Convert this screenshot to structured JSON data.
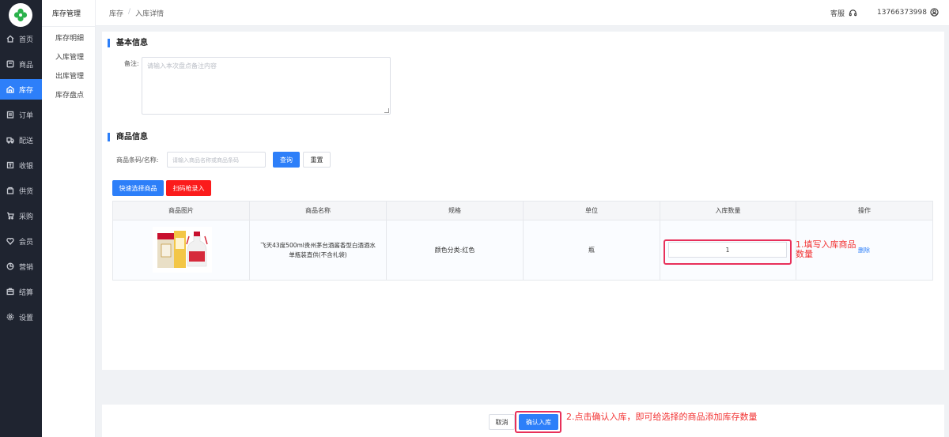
{
  "sidebar": {
    "items": [
      {
        "label": "首页",
        "icon": "home-icon",
        "active": false
      },
      {
        "label": "商品",
        "icon": "goods-icon",
        "active": false
      },
      {
        "label": "库存",
        "icon": "stock-icon",
        "active": true
      },
      {
        "label": "订单",
        "icon": "order-icon",
        "active": false
      },
      {
        "label": "配送",
        "icon": "truck-icon",
        "active": false
      },
      {
        "label": "收银",
        "icon": "cashier-icon",
        "active": false
      },
      {
        "label": "供货",
        "icon": "supply-icon",
        "active": false
      },
      {
        "label": "采购",
        "icon": "cart-icon",
        "active": false
      },
      {
        "label": "会员",
        "icon": "member-icon",
        "active": false
      },
      {
        "label": "营销",
        "icon": "marketing-icon",
        "active": false
      },
      {
        "label": "结算",
        "icon": "settle-icon",
        "active": false
      },
      {
        "label": "设置",
        "icon": "settings-icon",
        "active": false
      }
    ]
  },
  "subnav": {
    "title": "库存管理",
    "items": [
      "库存明细",
      "入库管理",
      "出库管理",
      "库存盘点"
    ]
  },
  "header": {
    "breadcrumb": [
      "库存",
      "入库详情"
    ],
    "service_label": "客服",
    "phone": "13766373998"
  },
  "basic": {
    "title": "基本信息",
    "remark_label": "备注:",
    "remark_placeholder": "请输入本次盘点备注内容"
  },
  "goods": {
    "title": "商品信息",
    "search_label": "商品条码/名称:",
    "search_placeholder": "请输入商品名称或商品条码",
    "query_button": "查询",
    "reset_button": "重置",
    "quick_select_button": "快速选择商品",
    "scan_button": "扫码枪录入",
    "columns": [
      "商品图片",
      "商品名称",
      "规格",
      "单位",
      "入库数量",
      "操作"
    ],
    "rows": [
      {
        "name": "飞天43度500ml贵州茅台酒酱香型白酒酒水单瓶装直供(不含礼袋)",
        "spec": "颜色分类:红色",
        "unit": "瓶",
        "qty": "1",
        "action": "删除"
      }
    ]
  },
  "annotations": {
    "step1": "1.填写入库商品数量",
    "step2": "2.点击确认入库，即可给选择的商品添加库存数量"
  },
  "footer": {
    "cancel_button": "取消",
    "confirm_button": "确认入库"
  },
  "colors": {
    "accent": "#2d7ff9",
    "sidebar_bg": "#1f2430",
    "danger": "#fb1b1b",
    "annotation": "#e8305a"
  }
}
